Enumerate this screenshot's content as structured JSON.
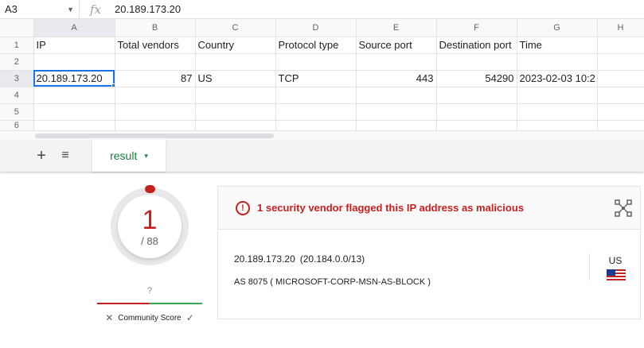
{
  "sheet": {
    "namebox": "A3",
    "formula_fx": "fx",
    "formula_value": "20.189.173.20",
    "column_headers": [
      "A",
      "B",
      "C",
      "D",
      "E",
      "F",
      "G",
      "H"
    ],
    "row_headers": [
      "1",
      "2",
      "3",
      "4",
      "5",
      "6"
    ],
    "header_row": [
      "IP",
      "Total vendors",
      "Country",
      "Protocol type",
      "Source port",
      "Destination port",
      "Time"
    ],
    "data_row": [
      "20.189.173.20",
      "87",
      "US",
      "TCP",
      "443",
      "54290",
      "2023-02-03 10:2"
    ],
    "add_sheet_icon": "+",
    "all_sheets_icon": "≡",
    "tab_label": "result",
    "tab_caret": "▾"
  },
  "detection": {
    "score": "1",
    "total": "/ 88",
    "community_question": "?",
    "community_label": "Community Score",
    "community_down": "✕",
    "community_up": "✓"
  },
  "card": {
    "alert_icon": "!",
    "alert_text": "1 security vendor flagged this IP address as malicious",
    "ip": "20.189.173.20",
    "ip_range": "(20.184.0.0/13)",
    "as_text": "AS 8075 ( MICROSOFT-CORP-MSN-AS-BLOCK )",
    "country_code": "US"
  },
  "colors": {
    "accent_red": "#c5221f",
    "accent_green": "#188038",
    "selection_blue": "#1a73e8"
  }
}
